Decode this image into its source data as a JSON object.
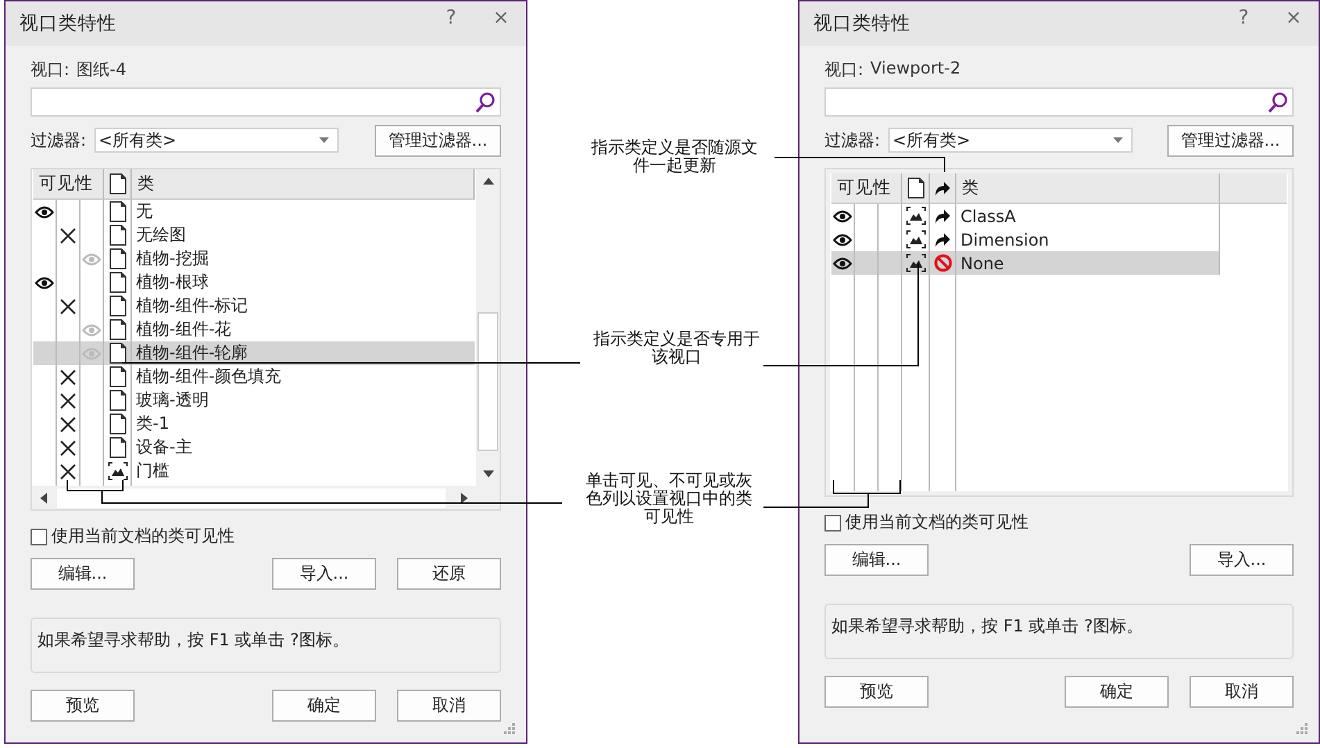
{
  "dialogs": [
    {
      "title": "视口类特性",
      "help_button": "?",
      "close_button": "×",
      "viewport_label": "视口:",
      "viewport_value": "图纸-4",
      "filter_label": "过滤器:",
      "filter_value": "<所有类>",
      "manage_button": "管理过滤器...",
      "scrollbars": true,
      "update_column": false,
      "columns": {
        "visibility": "可见性",
        "class": "类"
      },
      "rows": [
        {
          "name": "无",
          "visible": true,
          "greyed": false,
          "kind": "document",
          "selected": false
        },
        {
          "name": "无绘图",
          "visible": false,
          "kind": "document",
          "selected": false
        },
        {
          "name": "植物-挖掘",
          "visible": true,
          "greyed": true,
          "kind": "document",
          "selected": false
        },
        {
          "name": "植物-根球",
          "visible": true,
          "greyed": false,
          "kind": "document",
          "selected": false
        },
        {
          "name": "植物-组件-标记",
          "visible": false,
          "kind": "document",
          "selected": false
        },
        {
          "name": "植物-组件-花",
          "visible": true,
          "greyed": true,
          "kind": "document",
          "selected": false
        },
        {
          "name": "植物-组件-轮廓",
          "visible": true,
          "greyed": true,
          "kind": "document",
          "selected": true
        },
        {
          "name": "植物-组件-颜色填充",
          "visible": false,
          "kind": "document",
          "selected": false
        },
        {
          "name": "玻璃-透明",
          "visible": false,
          "kind": "document",
          "selected": false
        },
        {
          "name": "类-1",
          "visible": false,
          "kind": "document",
          "selected": false
        },
        {
          "name": "设备-主",
          "visible": false,
          "kind": "document",
          "selected": false
        },
        {
          "name": "门槛",
          "visible": false,
          "kind": "image",
          "selected": false
        }
      ],
      "checkbox": {
        "label": "使用当前文档的类可见性",
        "checked": false
      },
      "action_buttons": {
        "left": [
          "编辑..."
        ],
        "right": [
          "导入...",
          "还原"
        ]
      },
      "help_text": "如果希望寻求帮助，按 F1 或单击 ?图标。",
      "bottom_buttons": {
        "left": [
          "预览"
        ],
        "right": [
          "确定",
          "取消"
        ]
      }
    },
    {
      "title": "视口类特性",
      "help_button": "?",
      "close_button": "×",
      "viewport_label": "视口:",
      "viewport_value": "Viewport-2",
      "filter_label": "过滤器:",
      "filter_value": "<所有类>",
      "manage_button": "管理过滤器...",
      "scrollbars": false,
      "update_column": true,
      "columns": {
        "visibility": "可见性",
        "class": "类"
      },
      "rows": [
        {
          "name": "ClassA",
          "visible": true,
          "greyed": false,
          "kind": "image",
          "updates_with_source": true,
          "selected": false
        },
        {
          "name": "Dimension",
          "visible": true,
          "greyed": false,
          "kind": "image",
          "updates_with_source": true,
          "selected": false
        },
        {
          "name": "None",
          "visible": true,
          "greyed": false,
          "kind": "image",
          "updates_with_source": false,
          "selected": true
        }
      ],
      "checkbox": {
        "label": "使用当前文档的类可见性",
        "checked": false
      },
      "action_buttons": {
        "left": [
          "编辑..."
        ],
        "right": [
          "导入..."
        ]
      },
      "help_text": "如果希望寻求帮助，按 F1 或单击 ?图标。",
      "bottom_buttons": {
        "left": [
          "预览"
        ],
        "right": [
          "确定",
          "取消"
        ]
      }
    }
  ],
  "annotations": [
    {
      "text": "指示类定义是否随源文件一起更新"
    },
    {
      "text": "指示类定义是否专用于该视口"
    },
    {
      "text": "单击可见、不可见或灰色列以设置视口中的类可见性"
    }
  ]
}
